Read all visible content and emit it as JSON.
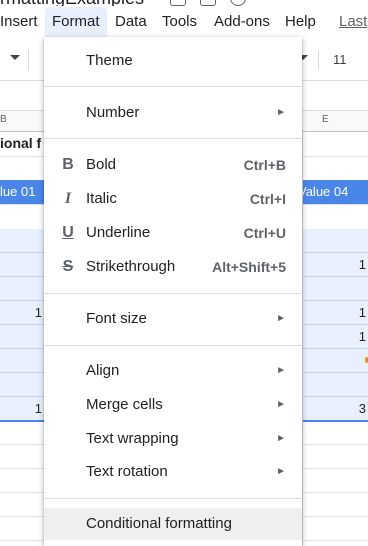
{
  "document": {
    "title": "rmattingExamples"
  },
  "menubar": {
    "items": [
      "Insert",
      "Format",
      "Data",
      "Tools",
      "Add-ons",
      "Help"
    ],
    "last_edit": "Last"
  },
  "toolbar": {
    "font_size": "11"
  },
  "columns": {
    "b": "B",
    "e": "E"
  },
  "sheet": {
    "title_fragment": "ional f",
    "header_left": "lue 01",
    "header_right": "Value 04",
    "left_values": [
      "",
      "",
      "",
      "1",
      "",
      "",
      "",
      "1"
    ],
    "right_values": [
      "",
      "",
      "1",
      "",
      "1",
      "1",
      "",
      "3"
    ]
  },
  "menu": {
    "theme": "Theme",
    "number": "Number",
    "bold": "Bold",
    "bold_shortcut": "Ctrl+B",
    "italic": "Italic",
    "italic_shortcut": "Ctrl+I",
    "underline": "Underline",
    "underline_shortcut": "Ctrl+U",
    "strikethrough": "Strikethrough",
    "strikethrough_shortcut": "Alt+Shift+5",
    "font_size": "Font size",
    "align": "Align",
    "merge_cells": "Merge cells",
    "text_wrapping": "Text wrapping",
    "text_rotation": "Text rotation",
    "conditional_formatting": "Conditional formatting",
    "icons": {
      "bold": "B",
      "italic": "I",
      "underline": "U",
      "strikethrough": "S",
      "submenu": "►"
    }
  }
}
